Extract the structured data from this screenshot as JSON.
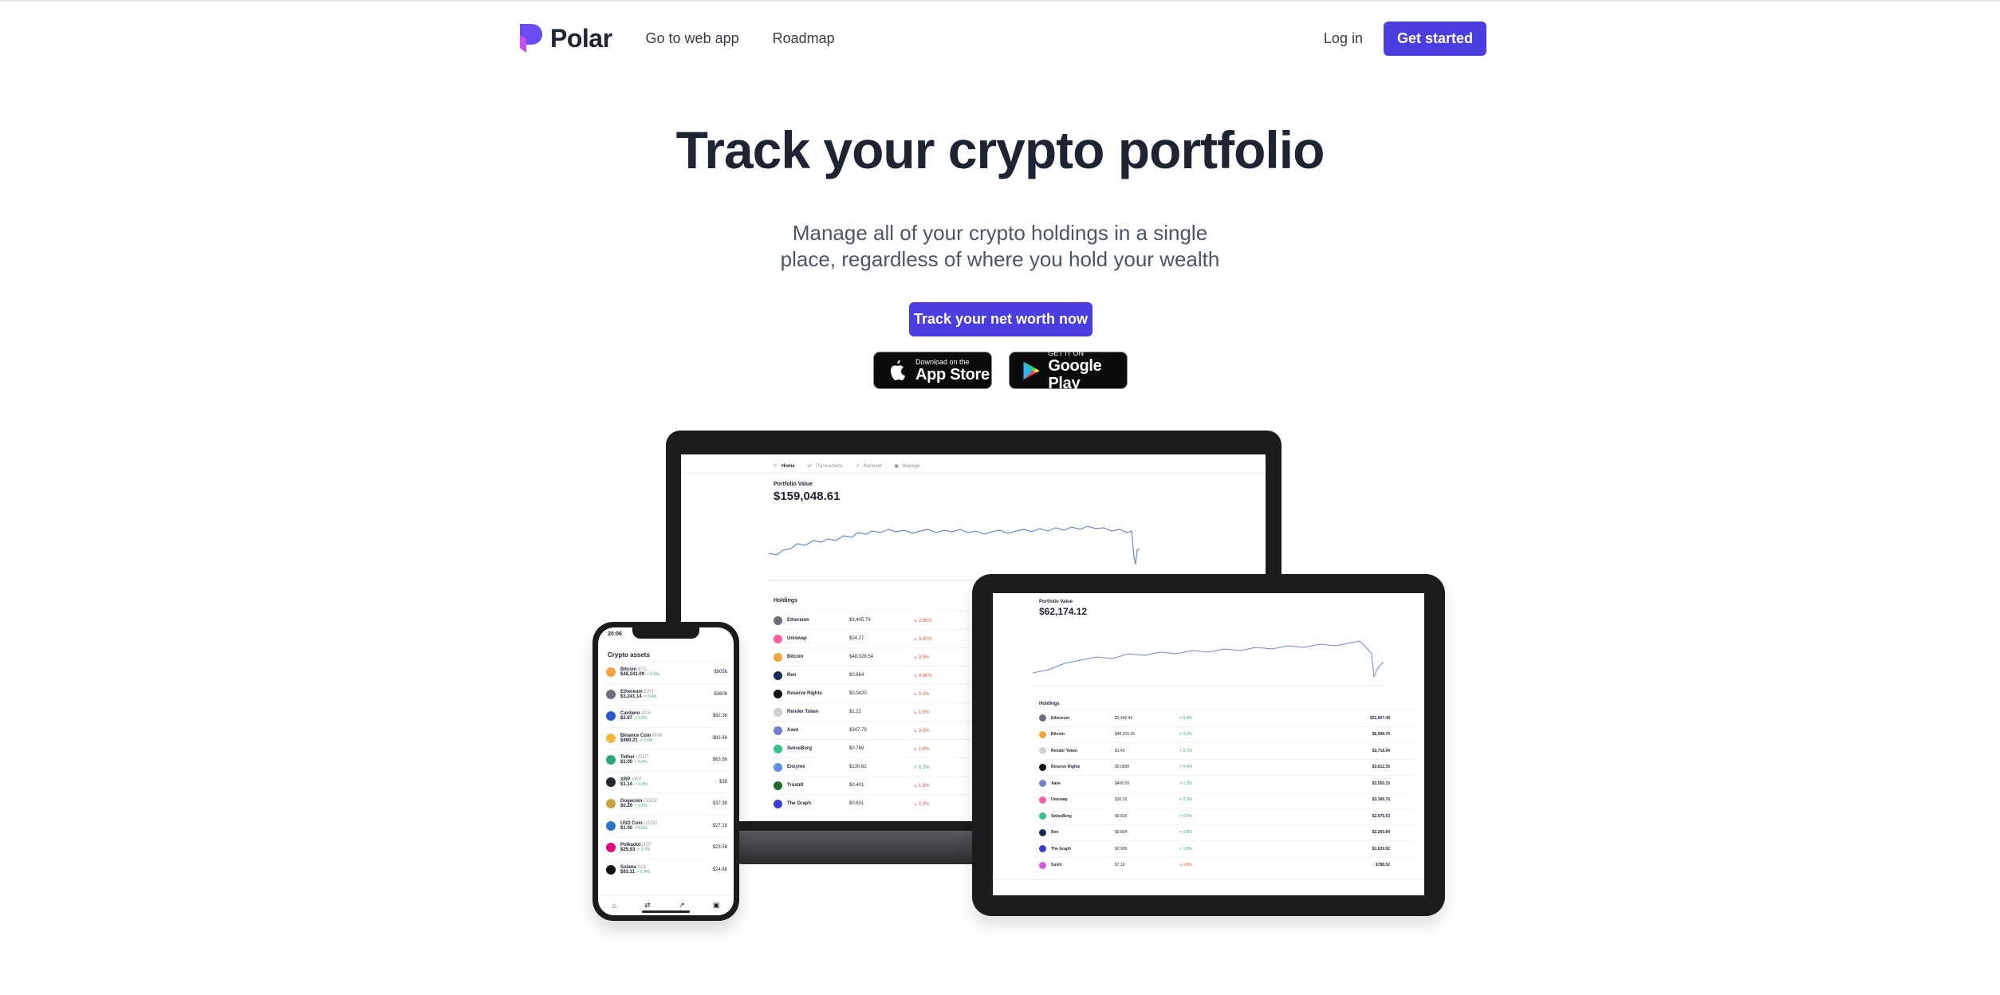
{
  "colors": {
    "primary": "#4b3ee0",
    "text": "#1f2433",
    "muted": "#4c5566",
    "device": "#1c1c1e"
  },
  "nav": {
    "brand": "Polar",
    "links": [
      "Go to web app",
      "Roadmap"
    ],
    "login": "Log in",
    "cta": "Get started"
  },
  "hero": {
    "title": "Track your crypto portfolio",
    "subtitle_line1": "Manage all of your crypto holdings in a single",
    "subtitle_line2": "place, regardless of where you hold your wealth",
    "cta": "Track your net worth now"
  },
  "stores": {
    "apple_small": "Download on the",
    "apple_big": "App Store",
    "google_small": "GET IT ON",
    "google_big": "Google Play"
  },
  "laptop": {
    "tabs": [
      "Home",
      "Transactions",
      "Renmod",
      "Manage"
    ],
    "portfolio_label": "Portfolio Value",
    "portfolio_value": "$159,048.61",
    "holdings_label": "Holdings",
    "holdings": [
      {
        "name": "Ethereum",
        "price": "$3,445.79",
        "change": "↘ 2.96%",
        "color": "#6b6f7b"
      },
      {
        "name": "Uniswap",
        "price": "$24.27",
        "change": "↘ 3.60%",
        "color": "#ff5ea0"
      },
      {
        "name": "Bitcoin",
        "price": "$48,028.54",
        "change": "↘ 3.9%",
        "color": "#f2a33a"
      },
      {
        "name": "Ren",
        "price": "$0.664",
        "change": "↘ 4.66%",
        "color": "#1c2b5a"
      },
      {
        "name": "Reserve Rights",
        "price": "$0.0420",
        "change": "↘ 3.2%",
        "color": "#111111"
      },
      {
        "name": "Render Token",
        "price": "$1.22",
        "change": "↘ 1.6%",
        "color": "#cfcfd4"
      },
      {
        "name": "Aave",
        "price": "$347.79",
        "change": "↘ 3.3%",
        "color": "#6f7fd6"
      },
      {
        "name": "SwissBorg",
        "price": "$0.769",
        "change": "↘ 1.8%",
        "color": "#36c28a"
      },
      {
        "name": "Enzyme",
        "price": "$130.62",
        "change": "↗ 0.2%",
        "color": "#5c8fe6"
      },
      {
        "name": "Trustdt",
        "price": "$0.401",
        "change": "↘ 1.9%",
        "color": "#1f6b2e"
      },
      {
        "name": "The Graph",
        "price": "$0.631",
        "change": "↘ 2.3%",
        "color": "#3b3bd0"
      }
    ]
  },
  "tablet": {
    "portfolio_label": "Portfolio Value",
    "portfolio_value": "$62,174.12",
    "holdings_label": "Holdings",
    "holdings": [
      {
        "name": "Ethereum",
        "price": "$3,442.40",
        "change": "↗ 0.4%",
        "value": "$31,907.49",
        "color": "#6b6f7b"
      },
      {
        "name": "Bitcoin",
        "price": "$48,015.05",
        "change": "↗ 0.2%",
        "value": "$6,908.76",
        "color": "#f2a33a"
      },
      {
        "name": "Render Token",
        "price": "$1.43",
        "change": "↗ 2.1%",
        "value": "$3,718.94",
        "color": "#cfcfd4"
      },
      {
        "name": "Reserve Rights",
        "price": "$0.0509",
        "change": "↗ 0.4%",
        "value": "$3,612.35",
        "color": "#111111"
      },
      {
        "name": "Aave",
        "price": "$406.09",
        "change": "↗ 1.2%",
        "value": "$3,550.15",
        "color": "#6f7fd6"
      },
      {
        "name": "Uniswap",
        "price": "$30.02",
        "change": "↗ 2.3%",
        "value": "$3,349.76",
        "color": "#ff5ea0"
      },
      {
        "name": "SwissBorg",
        "price": "$0.839",
        "change": "↗ 0.5%",
        "value": "$2,675.53",
        "color": "#36c28a"
      },
      {
        "name": "Ren",
        "price": "$0.804",
        "change": "↗ 0.9%",
        "value": "$2,293.84",
        "color": "#1c2b5a"
      },
      {
        "name": "The Graph",
        "price": "$0.909",
        "change": "↗ 1.0%",
        "value": "$1,639.92",
        "color": "#3b3bd0"
      },
      {
        "name": "Sushi",
        "price": "$7.16",
        "change": "↘ 0.8%",
        "value": "$788.52",
        "color": "#d65ae0"
      }
    ]
  },
  "phone": {
    "time": "20:06",
    "title": "Crypto assets",
    "assets": [
      {
        "name": "Bitcoin",
        "sym": "BTC",
        "price": "$48,241.09",
        "change": "↗ 0.2%",
        "value": "$9056",
        "color": "#f2a33a"
      },
      {
        "name": "Ethereum",
        "sym": "ETH",
        "price": "$3,241.14",
        "change": "↗ 0.4%",
        "value": "$3608",
        "color": "#6b6f7b"
      },
      {
        "name": "Cardano",
        "sym": "ADA",
        "price": "$2.87",
        "change": "↗ 0.2%",
        "value": "$82.38",
        "color": "#2a5ad0"
      },
      {
        "name": "Binance Coin",
        "sym": "BNB",
        "price": "$490.21",
        "change": "↗ 0.4%",
        "value": "$82.48",
        "color": "#f2b93a"
      },
      {
        "name": "Tether",
        "sym": "USDT",
        "price": "$1.00",
        "change": "↗ 0.0%",
        "value": "$63.68",
        "color": "#2aa77a"
      },
      {
        "name": "XRP",
        "sym": "XRP",
        "price": "$1.14",
        "change": "↗ 0.3%",
        "value": "$38",
        "color": "#23292f"
      },
      {
        "name": "Dogecoin",
        "sym": "DOGE",
        "price": "$0.29",
        "change": "↗ 0.5%",
        "value": "$37.38",
        "color": "#c8a23c"
      },
      {
        "name": "USD Coin",
        "sym": "USDC",
        "price": "$1.00",
        "change": "↗ 0.0%",
        "value": "$27.18",
        "color": "#2775ca"
      },
      {
        "name": "Polkadot",
        "sym": "DOT",
        "price": "$25.93",
        "change": "↗ 0.7%",
        "value": "$23.58",
        "color": "#e6007a"
      },
      {
        "name": "Solana",
        "sym": "SOL",
        "price": "$93.11",
        "change": "↗ 0.4%",
        "value": "$24.88",
        "color": "#111111"
      }
    ]
  }
}
